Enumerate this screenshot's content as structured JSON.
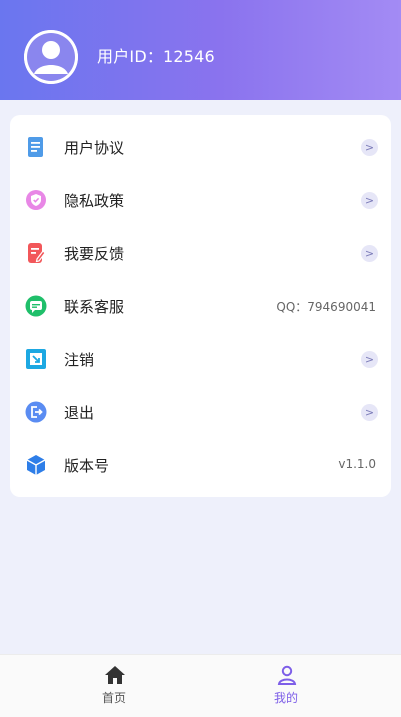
{
  "header": {
    "user_id_text": "用户ID：12546"
  },
  "menu": {
    "items": [
      {
        "label": "用户协议",
        "icon": "document-icon",
        "right": ">"
      },
      {
        "label": "隐私政策",
        "icon": "shield-icon",
        "right": ">"
      },
      {
        "label": "我要反馈",
        "icon": "feedback-icon",
        "right": ">"
      },
      {
        "label": "联系客服",
        "icon": "chat-icon",
        "right_text": "QQ：794690041"
      },
      {
        "label": "注销",
        "icon": "cancel-account-icon",
        "right": ">"
      },
      {
        "label": "退出",
        "icon": "logout-icon",
        "right": ">"
      },
      {
        "label": "版本号",
        "icon": "cube-icon",
        "right_text": "v1.1.0"
      }
    ]
  },
  "tabbar": {
    "tabs": [
      {
        "label": "首页",
        "icon": "home-icon",
        "active": false
      },
      {
        "label": "我的",
        "icon": "user-icon",
        "active": true
      }
    ]
  },
  "colors": {
    "header_start": "#6a76ef",
    "header_end": "#a38bf4",
    "active_tab": "#7d5ee8",
    "inactive_tab": "#555555"
  }
}
